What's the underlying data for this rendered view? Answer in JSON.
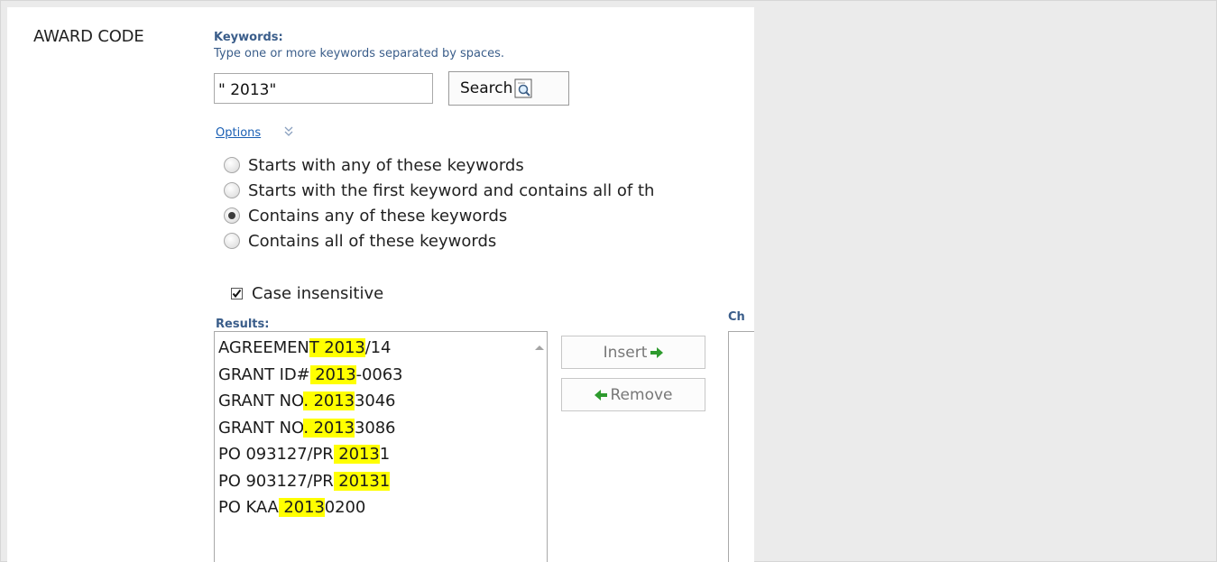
{
  "field": {
    "label": "AWARD CODE"
  },
  "keywords": {
    "label": "Keywords:",
    "help": "Type one or more keywords separated by spaces.",
    "value": "\" 2013\"",
    "search_label": "Search"
  },
  "options": {
    "link_label": "Options",
    "radios": [
      {
        "label": "Starts with any of these keywords",
        "checked": false
      },
      {
        "label": "Starts with the first keyword and contains all of th",
        "checked": false
      },
      {
        "label": "Contains any of these keywords",
        "checked": true
      },
      {
        "label": "Contains all of these keywords",
        "checked": false
      }
    ],
    "case_insensitive": {
      "label": "Case insensitive",
      "checked": true
    }
  },
  "results": {
    "label": "Results:",
    "items": [
      {
        "pre": "AGREEMEN",
        "hl": "T 2013",
        "post": "/14"
      },
      {
        "pre": "GRANT ID#",
        "hl": " 2013",
        "post": "-0063"
      },
      {
        "pre": "GRANT NO",
        "hl": ". 2013",
        "post": "3046"
      },
      {
        "pre": "GRANT NO",
        "hl": ". 2013",
        "post": "3086"
      },
      {
        "pre": "PO 093127/PR",
        "hl": " 2013",
        "post": "1"
      },
      {
        "pre": "PO 903127/PR",
        "hl": " 20131",
        "post": ""
      },
      {
        "pre": "PO KAA",
        "hl": " 2013",
        "post": "0200"
      }
    ]
  },
  "buttons": {
    "insert_label": "Insert",
    "remove_label": "Remove"
  },
  "chosen": {
    "label": "Ch"
  },
  "colors": {
    "highlight": "#ffff00",
    "label_blue": "#3a5d8a",
    "link_blue": "#1a5fb4",
    "arrow_green": "#2e9b2e"
  }
}
